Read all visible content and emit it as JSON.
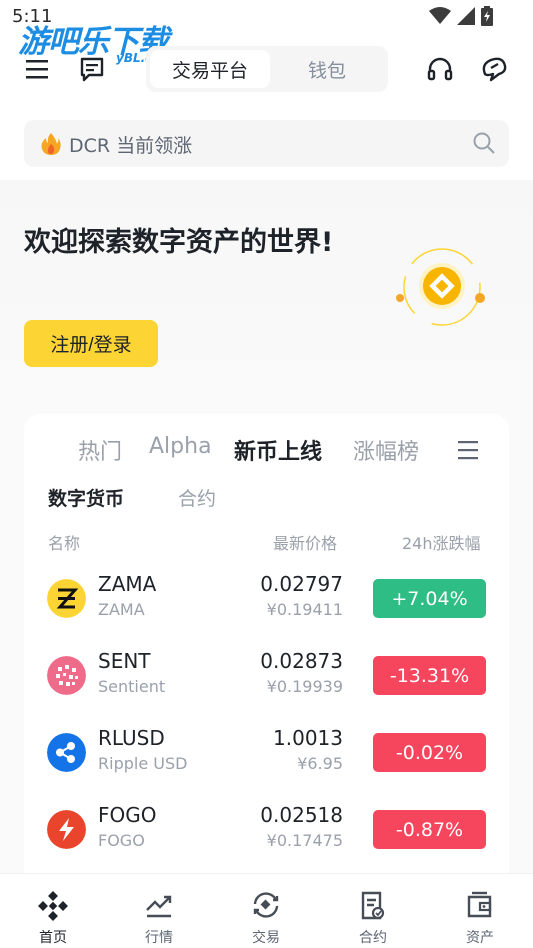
{
  "status": {
    "time": "5:11"
  },
  "watermark": {
    "text": "游吧乐下载",
    "sub": "yBL.com"
  },
  "topbar": {
    "segment_active": "交易平台",
    "segment_inactive": "钱包"
  },
  "search": {
    "placeholder": "DCR 当前领涨"
  },
  "hero": {
    "title": "欢迎探索数字资产的世界!",
    "cta": "注册/登录"
  },
  "market": {
    "tabs": [
      "热门",
      "Alpha",
      "新币上线",
      "涨幅榜"
    ],
    "active_tab": "新币上线",
    "subtabs": [
      "数字货币",
      "合约"
    ],
    "columns": {
      "name": "名称",
      "price": "最新价格",
      "change": "24h涨跌幅"
    },
    "rows": [
      {
        "symbol": "ZAMA",
        "name": "ZAMA",
        "price": "0.02797",
        "fiat": "¥0.19411",
        "change": "+7.04%",
        "direction": "up",
        "icon_color": "#fcd535"
      },
      {
        "symbol": "SENT",
        "name": "Sentient",
        "price": "0.02873",
        "fiat": "¥0.19939",
        "change": "-13.31%",
        "direction": "down",
        "icon_color": "#ef6b8a"
      },
      {
        "symbol": "RLUSD",
        "name": "Ripple USD",
        "price": "1.0013",
        "fiat": "¥6.95",
        "change": "-0.02%",
        "direction": "down",
        "icon_color": "#1473e6"
      },
      {
        "symbol": "FOGO",
        "name": "FOGO",
        "price": "0.02518",
        "fiat": "¥0.17475",
        "change": "-0.87%",
        "direction": "down",
        "icon_color": "#e8452c"
      }
    ]
  },
  "nav": {
    "items": [
      {
        "label": "首页",
        "icon": "binance-logo-icon",
        "active": true
      },
      {
        "label": "行情",
        "icon": "chart-trend-icon",
        "active": false
      },
      {
        "label": "交易",
        "icon": "trade-swap-icon",
        "active": false
      },
      {
        "label": "合约",
        "icon": "contract-doc-icon",
        "active": false
      },
      {
        "label": "资产",
        "icon": "wallet-icon",
        "active": false
      }
    ]
  },
  "colors": {
    "brand": "#fcd535",
    "up": "#2ebd85",
    "down": "#f6465d"
  }
}
